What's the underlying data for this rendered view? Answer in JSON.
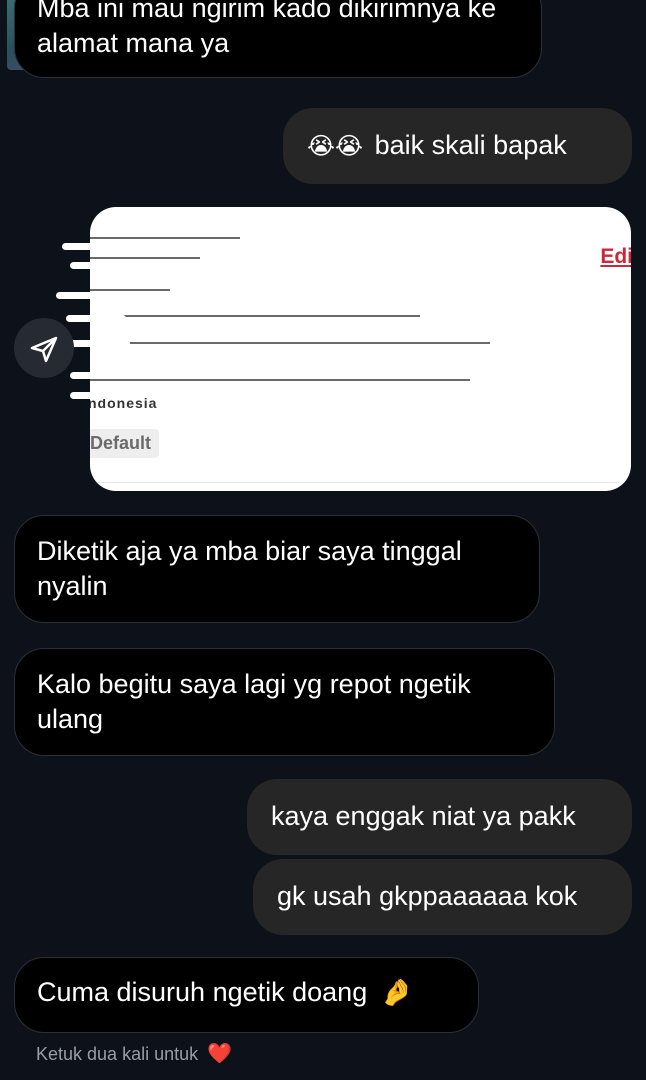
{
  "messages": {
    "m1": "Mba ini mau ngirim kado dikirimnya ke alamat mana ya",
    "m2_emoji": "😭😭",
    "m2_text": "baik skali bapak",
    "m3": "Diketik aja ya mba biar saya tinggal nyalin",
    "m4": "Kalo begitu saya lagi yg repot ngetik ulang",
    "m5": "kaya enggak niat ya pakk",
    "m6": "gk usah gkppaaaaaa kok",
    "m7": "Cuma disuruh ngetik doang",
    "m7_emoji": "🤌"
  },
  "card": {
    "edit_label": "Edi",
    "country_partial": "ndonesia",
    "default_badge": "Default"
  },
  "hint": {
    "text": "Ketuk dua kali untuk",
    "heart": "❤️"
  },
  "colors": {
    "background": "#0d111a",
    "incoming_bubble": "#000000",
    "outgoing_bubble": "#262626",
    "edit_accent": "#d0263a"
  }
}
